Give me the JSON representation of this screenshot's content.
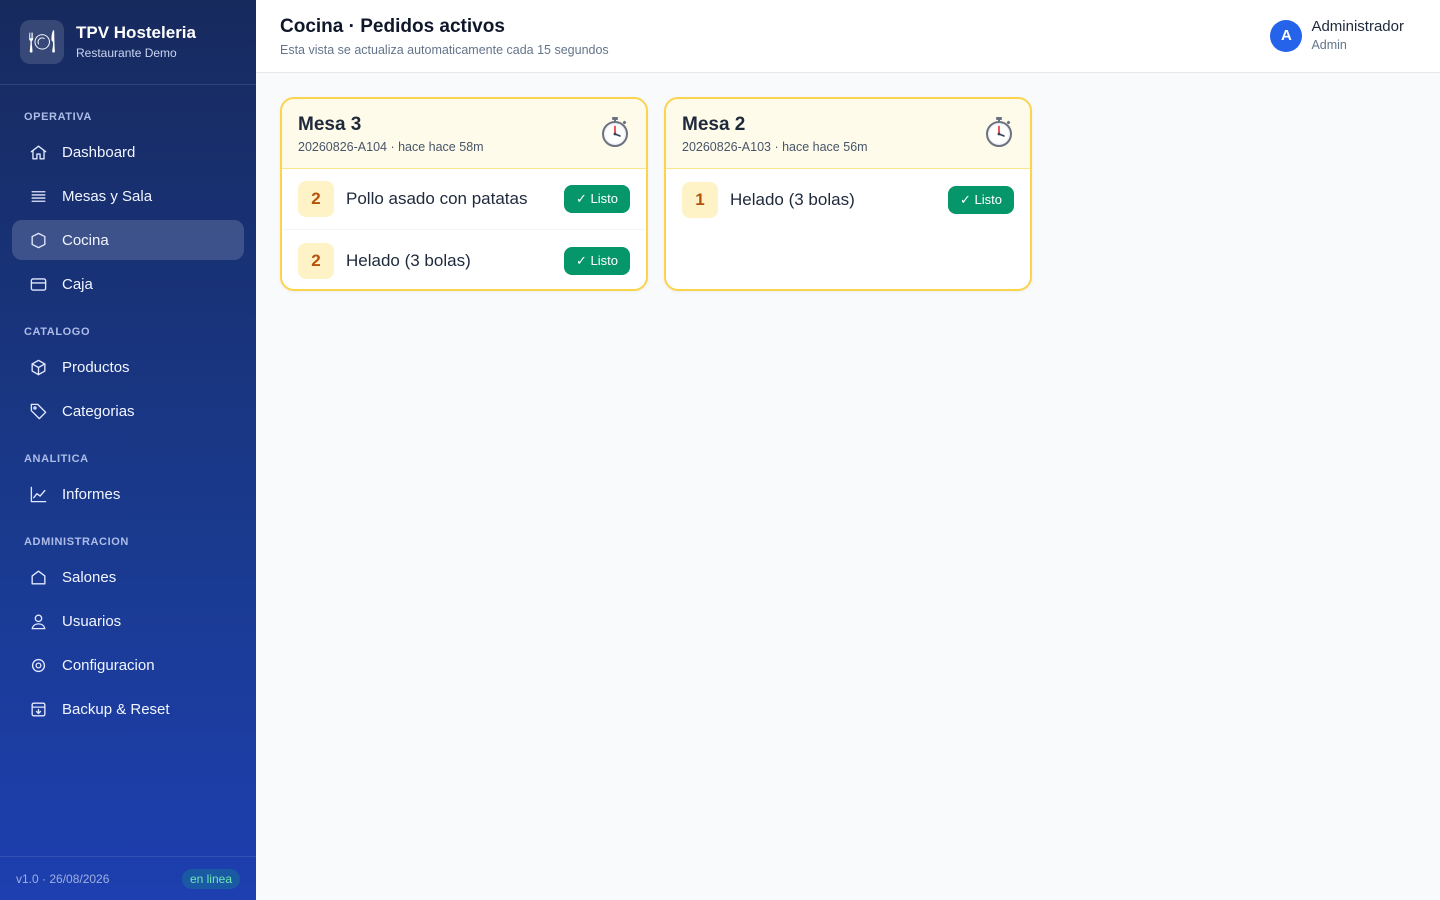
{
  "brand": {
    "logo_icon": "🍽",
    "title": "TPV Hosteleria",
    "subtitle": "Restaurante Demo"
  },
  "nav": {
    "sections": [
      {
        "label": "OPERATIVA"
      },
      {
        "label": "CATALOGO"
      },
      {
        "label": "ANALITICA"
      },
      {
        "label": "ADMINISTRACION"
      }
    ],
    "items": [
      {
        "label": "Dashboard",
        "icon": "home-icon"
      },
      {
        "label": "Mesas y Sala",
        "icon": "list-icon"
      },
      {
        "label": "Cocina",
        "icon": "shield-icon",
        "active": true
      },
      {
        "label": "Caja",
        "icon": "card-icon"
      },
      {
        "label": "Productos",
        "icon": "box-icon"
      },
      {
        "label": "Categorias",
        "icon": "tag-icon"
      },
      {
        "label": "Informes",
        "icon": "chart-icon"
      },
      {
        "label": "Salones",
        "icon": "house-icon"
      },
      {
        "label": "Usuarios",
        "icon": "user-icon"
      },
      {
        "label": "Configuracion",
        "icon": "gear-icon"
      },
      {
        "label": "Backup & Reset",
        "icon": "archive-icon"
      }
    ]
  },
  "footer": {
    "version": "v1.0 · 26/08/2026",
    "status": "en linea",
    "status_color": "#6ee7b7"
  },
  "header": {
    "title": "Cocina · Pedidos activos",
    "subtitle": "Esta vista se actualiza automaticamente cada 15 segundos",
    "user": {
      "initial": "A",
      "name": "Administrador",
      "role": "Admin",
      "avatar_color": "#2563eb"
    }
  },
  "orders": [
    {
      "table": "Mesa 3",
      "meta": "20260826-A104 · hace hace 58m",
      "timer_icon": "stopwatch-icon",
      "items": [
        {
          "qty": "2",
          "name": "Pollo asado con patatas",
          "action": "✓ Listo"
        },
        {
          "qty": "2",
          "name": "Helado (3 bolas)",
          "action": "✓ Listo"
        }
      ]
    },
    {
      "table": "Mesa 2",
      "meta": "20260826-A103 · hace hace 56m",
      "timer_icon": "stopwatch-icon",
      "items": [
        {
          "qty": "1",
          "name": "Helado (3 bolas)",
          "action": "✓ Listo"
        }
      ]
    }
  ],
  "colors": {
    "accent": "#059669",
    "card_border": "#fcd34d",
    "sidebar": "#1a3a8f"
  }
}
